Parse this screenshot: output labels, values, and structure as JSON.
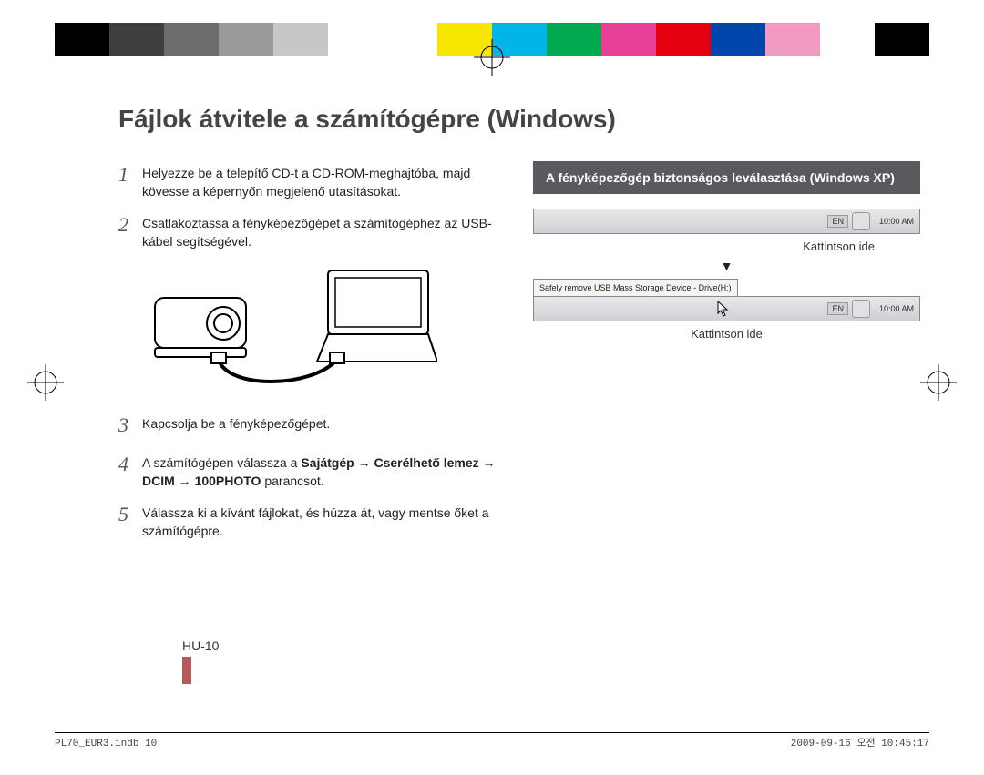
{
  "colorbar": [
    "#000000",
    "#3f3f3f",
    "#6d6d6d",
    "#9a9a9a",
    "#c7c7c7",
    "#ffffff",
    "#ffffff",
    "#f7e600",
    "#00b6e8",
    "#00a94f",
    "#e83f96",
    "#e3000f",
    "#0046ad",
    "#f29ac1",
    "#ffffff",
    "#000000"
  ],
  "title": "Fájlok átvitele a számítógépre (Windows)",
  "steps": {
    "s1": "Helyezze be a telepítő CD-t a CD-ROM-meghajtóba, majd kövesse a képernyőn megjelenő utasításokat.",
    "s2": "Csatlakoztassa a fényképezőgépet a számítógéphez az USB-kábel segítségével.",
    "s3": "Kapcsolja be a fényképezőgépet.",
    "s4_pre": "A számítógépen válassza a ",
    "s4_b1": "Sajátgép",
    "s4_arrow": " → ",
    "s4_b2": "Cserélhető lemez",
    "s4_b3": "DCIM",
    "s4_b4": "100PHOTO",
    "s4_post": " parancsot.",
    "s5": "Válassza ki a kívánt fájlokat, és húzza át, vagy mentse őket a számítógépre."
  },
  "banner": "A fényképezőgép biztonságos leválasztása (Windows XP)",
  "taskbar": {
    "lang": "EN",
    "time": "10:00 AM"
  },
  "caption1": "Kattintson ide",
  "balloon": "Safely remove USB Mass Storage Device - Drive(H:)",
  "caption2": "Kattintson ide",
  "page_num": "HU-10",
  "footer_left": "PL70_EUR3.indb   10",
  "footer_right": "2009-09-16   오전 10:45:17"
}
